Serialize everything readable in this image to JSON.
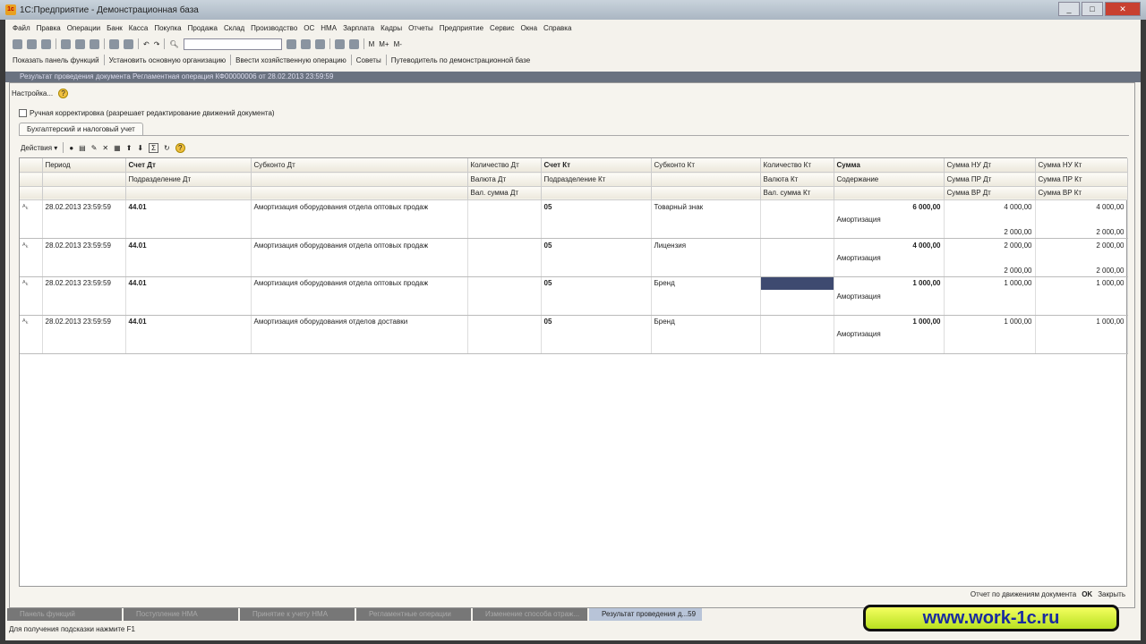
{
  "window": {
    "title": "1С:Предприятие - Демонстрационная база"
  },
  "menu": [
    "Файл",
    "Правка",
    "Операции",
    "Банк",
    "Касса",
    "Покупка",
    "Продажа",
    "Склад",
    "Производство",
    "ОС",
    "НМА",
    "Зарплата",
    "Кадры",
    "Отчеты",
    "Предприятие",
    "Сервис",
    "Окна",
    "Справка"
  ],
  "toolbar2": [
    "Показать панель функций",
    "Установить основную организацию",
    "Ввести хозяйственную операцию",
    "Советы",
    "Путеводитель по демонстрационной базе"
  ],
  "toolbar_m": [
    "M",
    "M+",
    "M-"
  ],
  "document": {
    "title": "Результат проведения документа Регламентная операция КФ00000006 от 28.02.2013 23:59:59",
    "settings": "Настройка...",
    "manual_checkbox": "Ручная корректировка (разрешает редактирование движений документа)",
    "tab": "Бухгалтерский и налоговый учет",
    "actions": "Действия",
    "footer": {
      "report": "Отчет по движениям документа",
      "ok": "OK",
      "close": "Закрыть"
    }
  },
  "headers": [
    [
      "",
      "Период",
      "Счет Дт",
      "Субконто Дт",
      "Количество Дт",
      "Счет Кт",
      "Субконто Кт",
      "Количество Кт",
      "Сумма",
      "Сумма НУ Дт",
      "Сумма НУ Кт"
    ],
    [
      "",
      "",
      "Подразделение Дт",
      "",
      "Валюта Дт",
      "Подразделение Кт",
      "",
      "Валюта Кт",
      "Содержание",
      "Сумма ПР Дт",
      "Сумма ПР Кт"
    ],
    [
      "",
      "",
      "",
      "",
      "Вал. сумма Дт",
      "",
      "",
      "Вал. сумма Кт",
      "",
      "Сумма ВР Дт",
      "Сумма ВР Кт"
    ]
  ],
  "rows": [
    {
      "period": "28.02.2013 23:59:59",
      "acc_dt": "44.01",
      "sub_dt": "Амортизация оборудования отдела оптовых продаж",
      "acc_kt": "05",
      "sub_kt": "Товарный знак",
      "sum": "6 000,00",
      "content": "Амортизация",
      "nu_dt": "4 000,00",
      "nu_kt": "4 000,00",
      "vr_dt": "2 000,00",
      "vr_kt": "2 000,00"
    },
    {
      "period": "28.02.2013 23:59:59",
      "acc_dt": "44.01",
      "sub_dt": "Амортизация оборудования отдела оптовых продаж",
      "acc_kt": "05",
      "sub_kt": "Лицензия",
      "sum": "4 000,00",
      "content": "Амортизация",
      "nu_dt": "2 000,00",
      "nu_kt": "2 000,00",
      "vr_dt": "2 000,00",
      "vr_kt": "2 000,00"
    },
    {
      "period": "28.02.2013 23:59:59",
      "acc_dt": "44.01",
      "sub_dt": "Амортизация оборудования отдела оптовых продаж",
      "acc_kt": "05",
      "sub_kt": "Бренд",
      "sum": "1 000,00",
      "content": "Амортизация",
      "nu_dt": "1 000,00",
      "nu_kt": "1 000,00",
      "vr_dt": "",
      "vr_kt": ""
    },
    {
      "period": "28.02.2013 23:59:59",
      "acc_dt": "44.01",
      "sub_dt": "Амортизация оборудования отделов доставки",
      "acc_kt": "05",
      "sub_kt": "Бренд",
      "sum": "1 000,00",
      "content": "Амортизация",
      "nu_dt": "1 000,00",
      "nu_kt": "1 000,00",
      "vr_dt": "",
      "vr_kt": ""
    }
  ],
  "taskbar": [
    "Панель функций",
    "Поступление НМА",
    "Принятие к учету НМА",
    "Регламентные операции",
    "Изменение способа отраж...",
    "Результат проведения д...59"
  ],
  "status": "Для получения подсказки нажмите F1",
  "watermark": "www.work-1c.ru"
}
